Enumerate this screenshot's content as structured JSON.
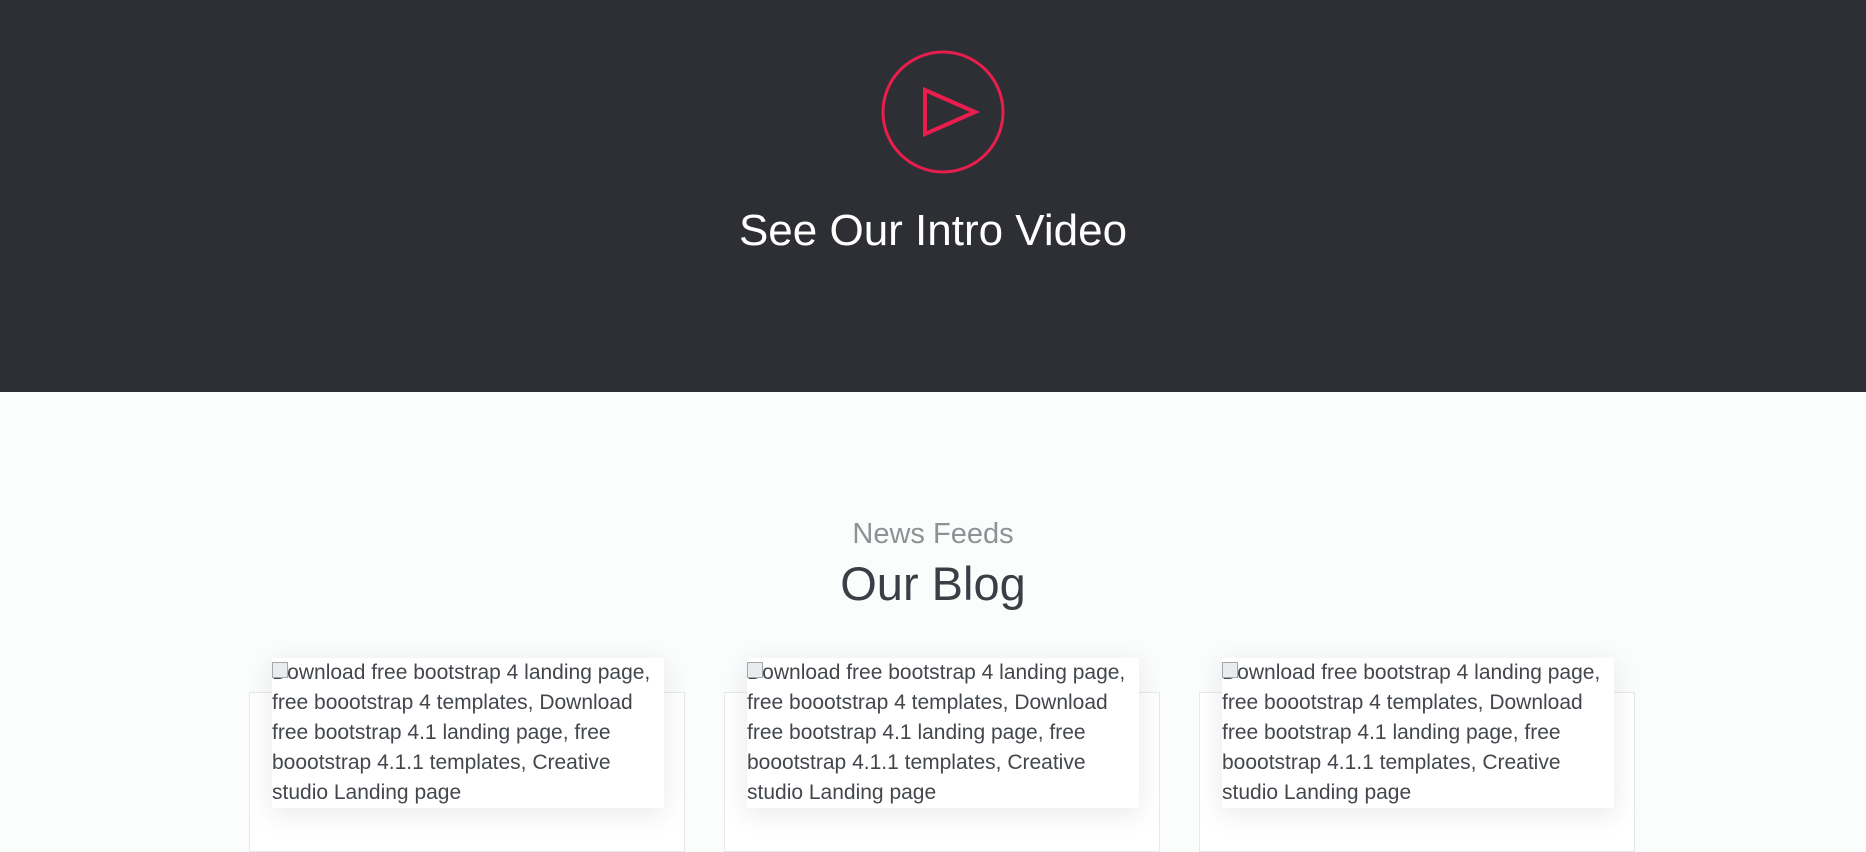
{
  "video_section": {
    "title": "See Our Intro Video",
    "accent_color": "#e91e4d",
    "background_color": "#2d2f34",
    "icon": "play-circle-icon"
  },
  "blog_section": {
    "subtitle": "News Feeds",
    "title": "Our Blog",
    "cards": [
      {
        "image_alt": "Download free bootstrap 4 landing page, free boootstrap 4 templates, Download free bootstrap 4.1 landing page, free boootstrap 4.1.1 templates, Creative studio Landing page"
      },
      {
        "image_alt": "Download free bootstrap 4 landing page, free boootstrap 4 templates, Download free bootstrap 4.1 landing page, free boootstrap 4.1.1 templates, Creative studio Landing page"
      },
      {
        "image_alt": "Download free bootstrap 4 landing page, free boootstrap 4 templates, Download free bootstrap 4.1 landing page, free boootstrap 4.1.1 templates, Creative studio Landing page"
      }
    ]
  }
}
